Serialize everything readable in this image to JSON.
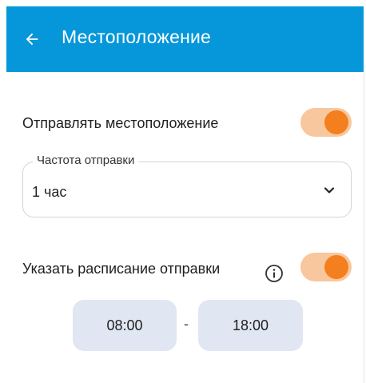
{
  "app_bar": {
    "title": "Местоположение",
    "back_icon": "arrow-left-icon",
    "background_color": "#0597d9"
  },
  "send_location": {
    "label": "Отправлять местоположение",
    "enabled": true
  },
  "frequency": {
    "legend": "Частота отправки",
    "value": "1 час",
    "chevron_icon": "chevron-down-icon"
  },
  "schedule": {
    "label": "Указать расписание отправки",
    "info_icon": "info-icon",
    "enabled": true,
    "start_time": "08:00",
    "separator": "-",
    "end_time": "18:00"
  },
  "colors": {
    "accent": "#f37f1e",
    "accent_track": "#f8c79d",
    "time_chip": "#e1e6f3"
  }
}
